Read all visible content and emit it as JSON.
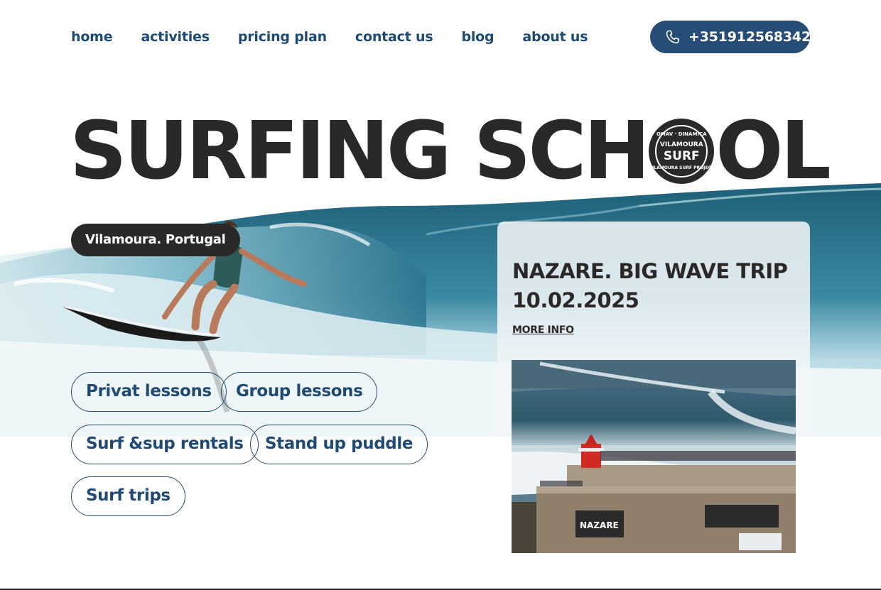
{
  "nav": {
    "items": [
      "home",
      "activities",
      "pricing plan",
      "contact us",
      "blog",
      "about us"
    ],
    "phone": "+351912568342",
    "phone_icon": "phone-icon"
  },
  "hero": {
    "title_start": "SURFING SCH",
    "title_end": "OL",
    "badge": {
      "top": "OMAV · DINAMICA",
      "mid": "VILAMOURA",
      "big": "SURF",
      "bottom": "VILAMOURA SURF PROJECT"
    },
    "location": "Vilamoura. Portugal"
  },
  "services": [
    "Privat lessons",
    "Group lessons",
    "Surf &sup rentals",
    "Stand up puddle",
    "Surf trips"
  ],
  "event": {
    "title_line1": "NAZARE. BIG WAVE TRIP",
    "title_line2": "10.02.2025",
    "link": "MORE INFO",
    "banner_text": "NAZARE"
  },
  "colors": {
    "brand_blue": "#254d75",
    "text_dark": "#2b2927",
    "wave_deep": "#2f6f86",
    "wave_light": "#8fc3d3"
  }
}
